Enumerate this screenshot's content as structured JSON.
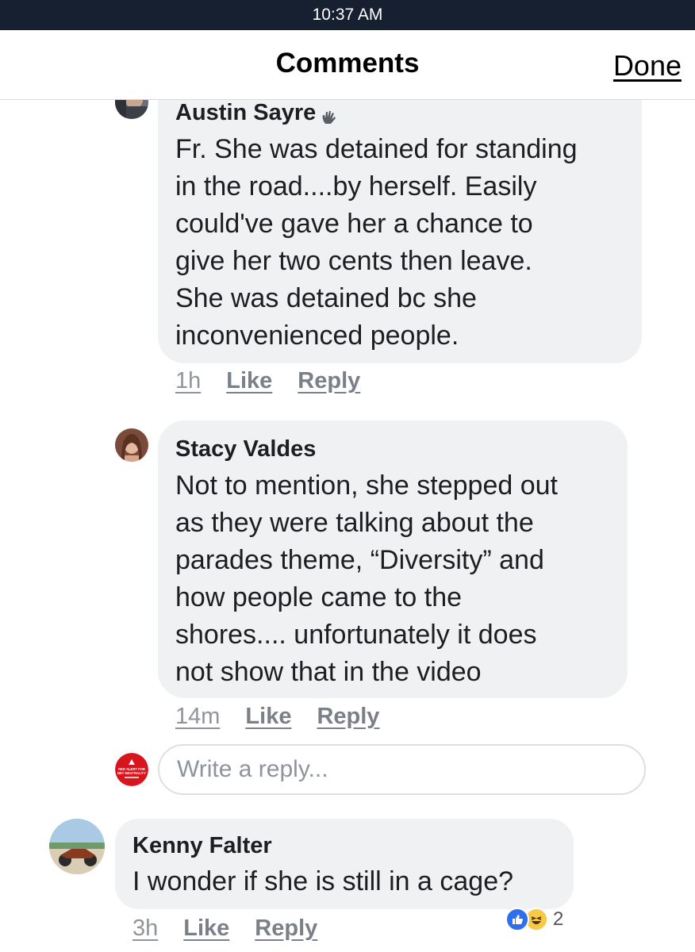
{
  "status_bar": {
    "time": "10:37 AM"
  },
  "header": {
    "title": "Comments",
    "done_label": "Done"
  },
  "comments": [
    {
      "author": "Austin Sayre",
      "lines": [
        "Fr. She was detained for standing",
        "in the road....by herself. Easily",
        "could've gave her a chance to",
        "give her two cents then leave.",
        "She was detained bc she",
        "inconvenienced people."
      ],
      "time": "1h",
      "like_label": "Like",
      "reply_label": "Reply"
    },
    {
      "author": "Stacy Valdes",
      "lines": [
        "Not to mention, she stepped out",
        "as they were talking about the",
        "parades theme, “Diversity” and",
        "how people came to the",
        "shores....  unfortunately it does",
        "not show that in the video"
      ],
      "time": "14m",
      "like_label": "Like",
      "reply_label": "Reply"
    },
    {
      "author": "Kenny Falter",
      "lines": [
        "I wonder if she is still in a cage?"
      ],
      "time": "3h",
      "like_label": "Like",
      "reply_label": "Reply",
      "reaction_count": "2"
    }
  ],
  "reply_box": {
    "placeholder": "Write a reply..."
  },
  "reply_avatar_text": {
    "line1": "RED ALERT FOR",
    "line2": "NET NEUTRALITY"
  },
  "icons": {
    "author_badge": "waving-hand-icon",
    "reactions": [
      "like-reaction-icon",
      "haha-reaction-icon"
    ]
  },
  "colors": {
    "status_bar_bg": "#172030",
    "bubble_bg": "#f0f1f3",
    "meta_text": "#90949c",
    "like_reaction": "#2e6fef",
    "haha_reaction": "#f7c84a",
    "red_alert": "#d8141c"
  }
}
